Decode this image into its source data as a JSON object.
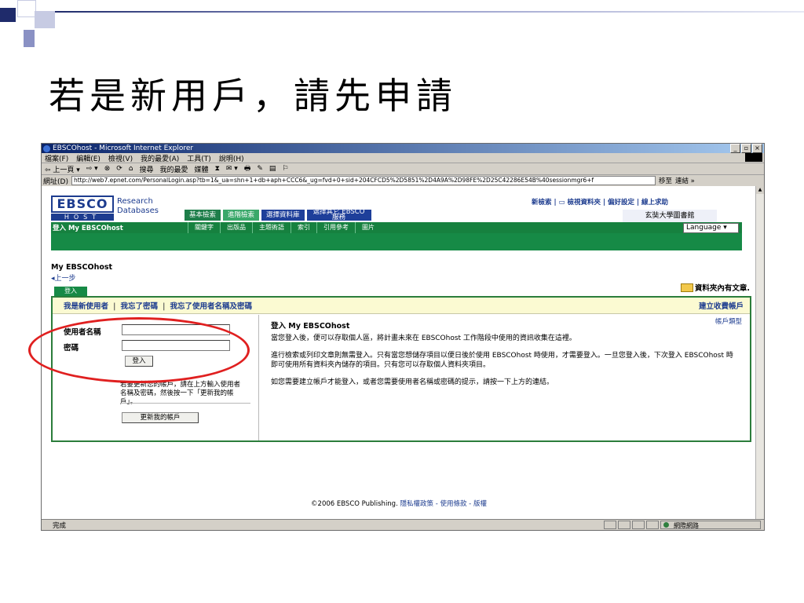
{
  "slide": {
    "title": "若是新用戶，請先申請"
  },
  "browser": {
    "window_title": "EBSCOhost - Microsoft Internet Explorer",
    "window_buttons": [
      "_",
      "▫",
      "×"
    ],
    "menu": [
      "檔案(F)",
      "編輯(E)",
      "檢視(V)",
      "我的最愛(A)",
      "工具(T)",
      "說明(H)"
    ],
    "toolbar": [
      "⇦ 上一頁 ▾",
      "⇨ ▾",
      "⊗",
      "⟳",
      "⌂",
      "搜尋",
      "我的最愛",
      "媒體",
      "⧗",
      "✉ ▾",
      "🖶",
      "✎",
      "▤",
      "⚐"
    ],
    "address_label": "網址(D)",
    "address_url": "http://web7.epnet.com/PersonalLogin.asp?tb=1&_ua=shn+1+db+aph+CCC6&_ug=fvd+0+sid+204CFCD5%2D5851%2D4A9A%2D98FE%2D25C42286E54B%40sessionmgr6+f",
    "go_label": "移至",
    "links_label": "連結 »",
    "status_text": "完成",
    "status_zone": "網際網路"
  },
  "page": {
    "logo_top": "EBSCO",
    "logo_bottom": "HOST",
    "logo_sub_1": "Research",
    "logo_sub_2": "Databases",
    "tabs": [
      "基本檢索",
      "進階檢索",
      "選擇資料庫",
      "選擇其它 EBSCO 服務"
    ],
    "toplinks": "新檢索 | ▭ 檢視資料夾 | 偏好設定 | 線上求助",
    "library_name": "玄奘大學圖書館",
    "login_bar": "登入 My EBSCOhost",
    "subtabs": [
      "關鍵字",
      "出版品",
      "主題術語",
      "索引",
      "引用參考",
      "圖片"
    ],
    "language": "Language ▾",
    "my_ebsco": "My EBSCOhost",
    "back": "◂上一步",
    "folder_note": "資料夾內有文章.",
    "login_tab": "登入",
    "panel_links": [
      "我是新使用者",
      "我忘了密碼",
      "我忘了使用者名稱及密碼"
    ],
    "create_account": "建立收費帳戶",
    "username_label": "使用者名稱",
    "password_label": "密碼",
    "username_value": "",
    "password_value": "",
    "login_button": "登入",
    "update_note": "若要更新您的帳戶，請在上方輸入使用者名稱及密碼，然後按一下「更新我的帳戶」。",
    "update_button": "更新我的帳戶",
    "right_title": "登入 My EBSCOhost",
    "account_type": "帳戶類型",
    "para1": "當您登入後，便可以存取個人區，將計畫未來在 EBSCOhost 工作階段中使用的資訊收集在這裡。",
    "para2": "進行檢索或列印文章則無需登入。只有當您想儲存項目以便日後於使用 EBSCOhost 時使用，才需要登入。一旦您登入後，下次登入 EBSCOhost 時即可使用所有資料夾內儲存的項目。只有您可以存取個人資料夾項目。",
    "para3": "如您需要建立帳戶才能登入，或者您需要使用者名稱或密碼的提示，請按一下上方的連結。",
    "footer_copy": "©2006 EBSCO Publishing.",
    "footer_links": "隱私權政策 - 使用條款 - 版權"
  },
  "colors": {
    "ebsco_blue": "#1d3c8f",
    "ebsco_green": "#16813f",
    "annotation_red": "#e02020"
  }
}
